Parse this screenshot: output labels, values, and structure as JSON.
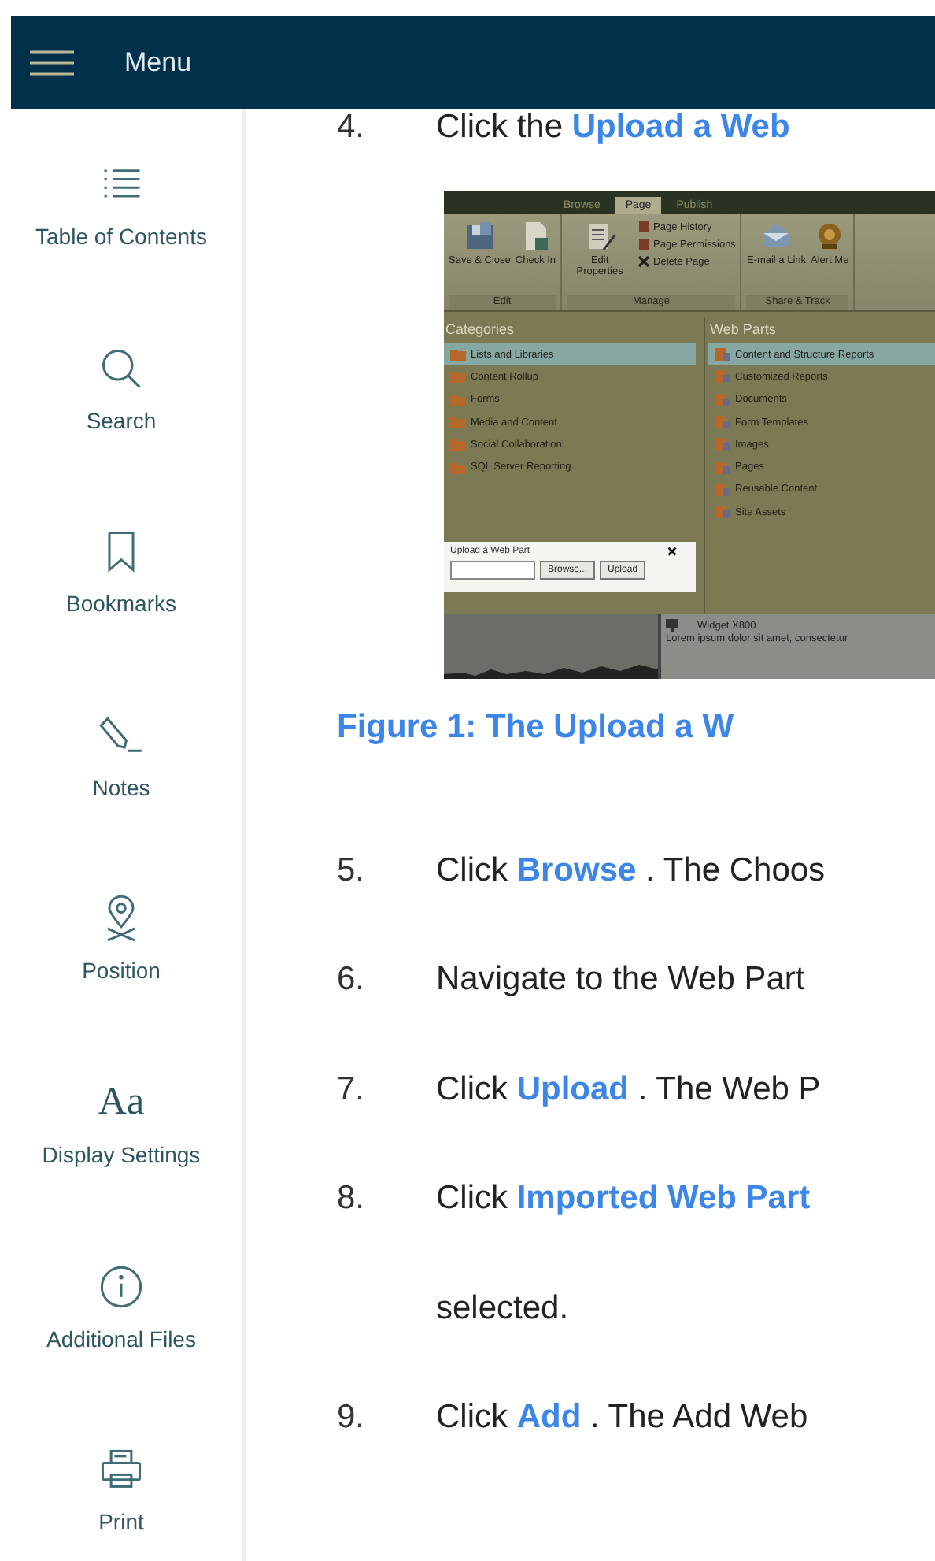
{
  "header": {
    "label": "Menu"
  },
  "sidebar": {
    "items": [
      {
        "label": "Table of Contents",
        "kind": "toc"
      },
      {
        "label": "Search",
        "kind": "search"
      },
      {
        "label": "Bookmarks",
        "kind": "bookmark"
      },
      {
        "label": "Notes",
        "kind": "notes"
      },
      {
        "label": "Position",
        "kind": "position"
      },
      {
        "label": "Display Settings",
        "kind": "glyph",
        "glyph": "Aa"
      },
      {
        "label": "Additional Files",
        "kind": "info"
      },
      {
        "label": "Print",
        "kind": "print"
      }
    ]
  },
  "steps_before": [
    {
      "number": "4.",
      "lines": [
        "Click the **Upload a Web**"
      ]
    }
  ],
  "figure": {
    "tabs": [
      {
        "label": "Browse",
        "selected": false
      },
      {
        "label": "Page",
        "selected": true
      },
      {
        "label": "Publish",
        "selected": false
      }
    ],
    "ribbon_groups": [
      {
        "label": "Edit",
        "buttons": [
          {
            "label": "Save & Close",
            "kind": "save"
          },
          {
            "label": "Check In",
            "kind": "checkin"
          }
        ]
      },
      {
        "label": "Manage",
        "buttons": [
          {
            "label": "Edit Properties",
            "kind": "edit"
          }
        ],
        "small_buttons": [
          {
            "label": "Page History",
            "kind": "page"
          },
          {
            "label": "Page Permissions",
            "kind": "page"
          },
          {
            "label": "Delete Page",
            "kind": "delete"
          }
        ]
      },
      {
        "label": "Share & Track",
        "buttons": [
          {
            "label": "E-mail a Link",
            "kind": "email"
          },
          {
            "label": "Alert Me",
            "kind": "alert"
          }
        ]
      }
    ],
    "categories": {
      "title": "Categories",
      "items": [
        {
          "label": "Lists and Libraries",
          "selected": true
        },
        {
          "label": "Content Rollup",
          "selected": false
        },
        {
          "label": "Forms",
          "selected": false
        },
        {
          "label": "Media and Content",
          "selected": false
        },
        {
          "label": "Social Collaboration",
          "selected": false
        },
        {
          "label": "SQL Server Reporting",
          "selected": false
        }
      ]
    },
    "web_parts": {
      "title": "Web Parts",
      "items": [
        {
          "label": "Content and Structure Reports",
          "selected": true
        },
        {
          "label": "Customized Reports",
          "selected": false
        },
        {
          "label": "Documents",
          "selected": false
        },
        {
          "label": "Form Templates",
          "selected": false
        },
        {
          "label": "Images",
          "selected": false
        },
        {
          "label": "Pages",
          "selected": false
        },
        {
          "label": "Reusable Content",
          "selected": false
        },
        {
          "label": "Site Assets",
          "selected": false
        }
      ]
    },
    "upload_dialog": {
      "title": "Upload a Web Part",
      "buttons": [
        "Browse...",
        "Upload"
      ]
    },
    "widget": {
      "title": "Widget X800",
      "text": "Lorem ipsum dolor sit amet, consectetur"
    }
  },
  "caption": "Figure 1: The Upload a W",
  "steps_after": [
    {
      "number": "5.",
      "lines": [
        "Click **Browse** . The Choos"
      ]
    },
    {
      "number": "6.",
      "lines": [
        "Navigate to the Web Part"
      ]
    },
    {
      "number": "7.",
      "lines": [
        "Click **Upload** . The Web P"
      ]
    },
    {
      "number": "8.",
      "lines": [
        "Click **Imported Web Part**",
        "selected."
      ]
    },
    {
      "number": "9.",
      "lines": [
        "Click **Add** . The Add Web"
      ]
    }
  ]
}
